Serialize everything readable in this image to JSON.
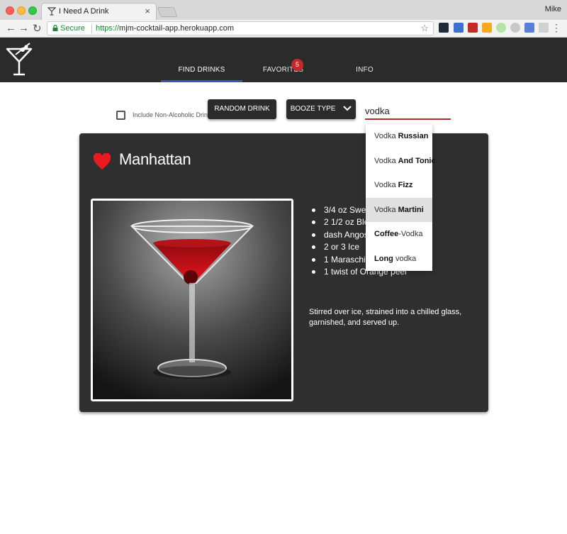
{
  "browser": {
    "tab_title": "I Need A Drink",
    "tab_close": "×",
    "profile_name": "Mike",
    "secure_label": "Secure",
    "url_scheme": "https://",
    "url_host": "mjm-cocktail-app.herokuapp.com",
    "nav": {
      "back": "←",
      "forward": "→",
      "reload": "↻",
      "star": "☆",
      "menu": "⋮"
    }
  },
  "header": {
    "nav": [
      {
        "label": "FIND DRINKS",
        "active": true
      },
      {
        "label": "FAVORITES",
        "badge": "5"
      },
      {
        "label": "INFO"
      }
    ]
  },
  "controls": {
    "non_alcoholic_label": "Include Non-Alcoholic Drinks",
    "random_button": "RANDOM DRINK",
    "booze_type_button": "BOOZE TYPE",
    "search_value": "vodka"
  },
  "autocomplete": [
    {
      "prefix": "Vodka ",
      "bold": "Russian",
      "suffix": ""
    },
    {
      "prefix": "Vodka ",
      "bold": "And Tonic",
      "suffix": ""
    },
    {
      "prefix": "Vodka ",
      "bold": "Fizz",
      "suffix": ""
    },
    {
      "prefix": "Vodka ",
      "bold": "Martini",
      "suffix": "",
      "highlighted": true
    },
    {
      "prefix": "",
      "bold": "Coffee",
      "suffix": "-Vodka"
    },
    {
      "prefix": "",
      "bold": "Long",
      "suffix": " vodka"
    }
  ],
  "drink": {
    "name": "Manhattan",
    "favorite": true,
    "ingredients": [
      "3/4 oz Sweet Vermouth",
      "2 1/2 oz Blended Bourbon",
      "dash Angostura bitters",
      "2 or 3 Ice",
      "1 Maraschino cherry",
      "1 twist of Orange peel"
    ],
    "instructions": "Stirred over ice, strained into a chilled glass, garnished, and served up."
  },
  "colors": {
    "appbar": "#2b2b2b",
    "accent": "#3f51b5",
    "badge": "#c62828",
    "heart": "#e8191f",
    "search_underline": "#c0272d"
  }
}
